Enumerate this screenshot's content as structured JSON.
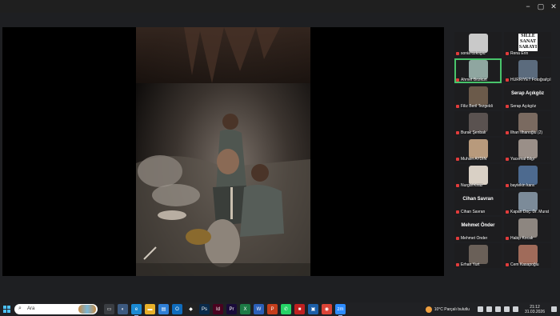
{
  "window": {
    "minimize_icon": "−",
    "restore_icon": "▢",
    "close_icon": "✕"
  },
  "participants": [
    {
      "name": "sonia ozkoğlu",
      "kind": "video",
      "color": "#c9c9c9"
    },
    {
      "name": "Rena Erin",
      "kind": "logo",
      "logo_lines": [
        "SILLE",
        "SANAT",
        "SARAYI"
      ]
    },
    {
      "name": "Ahmet Bozkurt",
      "kind": "video",
      "color": "#8fa6a0",
      "active": true
    },
    {
      "name": "HURRIYET Fotoğrafçılık N",
      "kind": "video",
      "color": "#5b6b7d"
    },
    {
      "name": "Filiz Beril Tezgeldi",
      "kind": "video",
      "color": "#6b5a4a"
    },
    {
      "name": "Serap Açıkgöz",
      "kind": "text",
      "display": "Serap Açıkgöz"
    },
    {
      "name": "Burak Şenbalı",
      "kind": "video",
      "color": "#5a5250"
    },
    {
      "name": "İlhan İlhanoğlu (2)",
      "kind": "video",
      "color": "#7a6a60"
    },
    {
      "name": "Muhsin AYDIN",
      "kind": "video",
      "color": "#b89a7c"
    },
    {
      "name": "Yacemal Bilgi",
      "kind": "video",
      "color": "#9a8f88"
    },
    {
      "name": "Nurgül Kiraz",
      "kind": "video",
      "color": "#d9d0c5"
    },
    {
      "name": "baytekin kara",
      "kind": "video",
      "color": "#4d6a8f"
    },
    {
      "name": "Cihan Savran",
      "kind": "text",
      "display": "Cihan Savran"
    },
    {
      "name": "Kapan Doç. Dr. Murat",
      "kind": "video",
      "color": "#7c8b99"
    },
    {
      "name": "Mehmet Önder",
      "kind": "text",
      "display": "Mehmet Önder"
    },
    {
      "name": "Habip Kocak",
      "kind": "video",
      "color": "#8d8680"
    },
    {
      "name": "Erhan Yurt",
      "kind": "video",
      "color": "#6a6058"
    },
    {
      "name": "Cem Kasapoğlu",
      "kind": "video",
      "color": "#a06b5a"
    }
  ],
  "taskbar": {
    "start_icon": "windows-icon",
    "search_placeholder": "Ara",
    "search_icon": "⌕",
    "apps": [
      {
        "name": "taskview",
        "color": "#3a3d42",
        "glyph": "▭",
        "open": false
      },
      {
        "name": "widgets",
        "color": "#3d5a80",
        "glyph": "◐",
        "open": false
      },
      {
        "name": "edge",
        "color": "#1b8ad3",
        "glyph": "e",
        "open": true
      },
      {
        "name": "file-explorer",
        "color": "#e8b02a",
        "glyph": "▬",
        "open": false
      },
      {
        "name": "store",
        "color": "#2f7fd6",
        "glyph": "▤",
        "open": false
      },
      {
        "name": "outlook",
        "color": "#0f6cbd",
        "glyph": "O",
        "open": false
      },
      {
        "name": "capcut",
        "color": "#222",
        "glyph": "◆",
        "open": false
      },
      {
        "name": "photoshop",
        "color": "#0a2a4a",
        "glyph": "Ps",
        "open": false
      },
      {
        "name": "indesign",
        "color": "#49021f",
        "glyph": "Id",
        "open": false
      },
      {
        "name": "premiere",
        "color": "#1a0b3a",
        "glyph": "Pr",
        "open": false
      },
      {
        "name": "excel",
        "color": "#1d7a45",
        "glyph": "X",
        "open": false
      },
      {
        "name": "word",
        "color": "#2b5fb8",
        "glyph": "W",
        "open": false
      },
      {
        "name": "powerpoint",
        "color": "#c43e1c",
        "glyph": "P",
        "open": false
      },
      {
        "name": "whatsapp",
        "color": "#25d366",
        "glyph": "✆",
        "open": false
      },
      {
        "name": "app-red",
        "color": "#c02020",
        "glyph": "■",
        "open": false
      },
      {
        "name": "app-blue",
        "color": "#1c5fa8",
        "glyph": "▣",
        "open": false
      },
      {
        "name": "chrome",
        "color": "#db4437",
        "glyph": "◉",
        "open": false
      },
      {
        "name": "zoom",
        "color": "#2d8cff",
        "glyph": "zm",
        "open": true
      }
    ],
    "weather": {
      "temp": "10°C",
      "desc": "Parçalı bulutlu"
    },
    "time": "21:12",
    "date": "31.03.2026"
  }
}
